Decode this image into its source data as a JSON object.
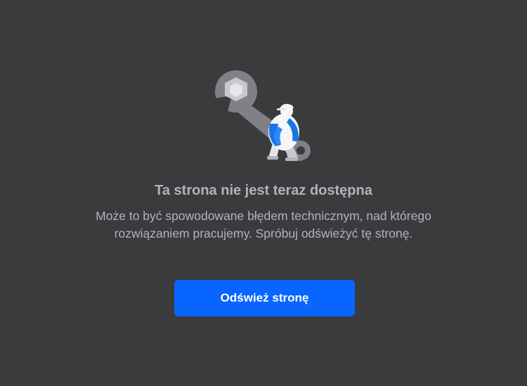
{
  "error": {
    "illustration_icon": "broken-wrench-worker-icon",
    "title": "Ta strona nie jest teraz dostępna",
    "message": "Może to być spowodowane błędem technicznym, nad którego rozwiązaniem pracujemy. Spróbuj odświeżyć tę stronę.",
    "reload_label": "Odśwież stronę"
  },
  "colors": {
    "background": "#3a3b3d",
    "text_secondary": "#b0b3b8",
    "primary_button": "#0866ff",
    "wrench": "#7f8185",
    "worker_blue": "#1b74e4"
  }
}
